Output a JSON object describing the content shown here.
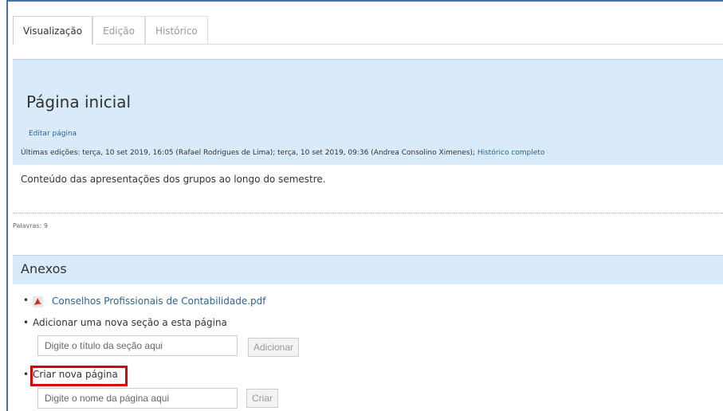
{
  "tabs": [
    {
      "label": "Visualização",
      "active": true
    },
    {
      "label": "Edição",
      "active": false
    },
    {
      "label": "Histórico",
      "active": false
    }
  ],
  "page": {
    "title": "Página inicial",
    "edit_link": "Editar página",
    "last_edits_text": "Últimas edições: terça, 10 set 2019, 16:05 (Rafael Rodrigues de Lima); terça, 10 set 2019, 09:36 (Andrea Consolino Ximenes);",
    "full_history_link": "Histórico completo",
    "content": "Conteúdo das apresentações dos grupos ao longo do semestre.",
    "word_count": "Palavras: 9"
  },
  "attachments": {
    "title": "Anexos",
    "files": [
      {
        "name": "Conselhos Profissionais de Contabilidade.pdf",
        "icon": "pdf-icon"
      }
    ]
  },
  "add_section": {
    "label": "Adicionar uma nova seção a esta página",
    "placeholder": "Digite o título da seção aqui",
    "button": "Adicionar"
  },
  "create_page": {
    "label": "Criar nova página",
    "placeholder": "Digite o nome da página aqui",
    "button": "Criar"
  },
  "colors": {
    "accent_link": "#2a6496",
    "band_bg": "#d9eafa",
    "highlight": "#e00000"
  }
}
